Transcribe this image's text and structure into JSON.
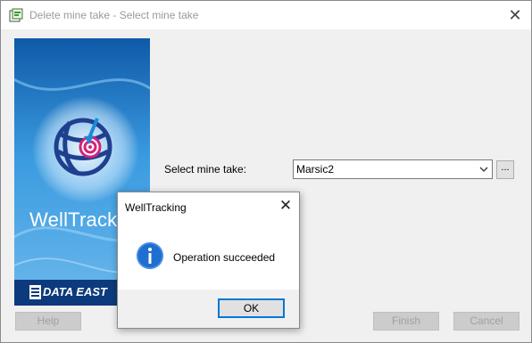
{
  "window": {
    "title": "Delete mine take - Select mine take",
    "close_glyph": "✕"
  },
  "banner": {
    "brand": "WellTracking",
    "footer_text": "DATA EAST"
  },
  "form": {
    "mine_take_label": "Select mine take:",
    "mine_take_value": "Marsic2",
    "browse_label": "..."
  },
  "buttons": {
    "help": "Help",
    "finish": "Finish",
    "cancel": "Cancel"
  },
  "dialog": {
    "title": "WellTracking",
    "close_glyph": "✕",
    "icon": "info-icon",
    "message": "Operation succeeded",
    "ok": "OK"
  },
  "colors": {
    "accent": "#0078d7",
    "banner_blue": "#1e78c4",
    "banner_footer": "#0d3a7c",
    "disabled_text": "#a0a0a0"
  }
}
